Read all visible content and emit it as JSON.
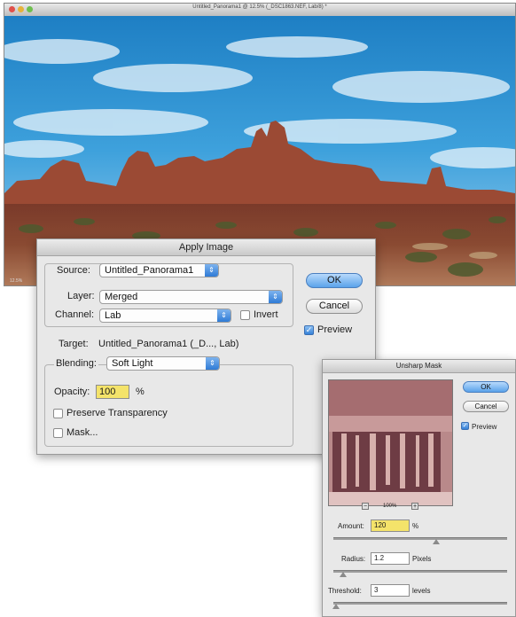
{
  "document_window": {
    "title": "Untitled_Panorama1 @ 12.5% (_DSC1863.NEF, Lab/8) *",
    "zoom": "12.5%"
  },
  "apply_image": {
    "title": "Apply Image",
    "source_label": "Source:",
    "source_value": "Untitled_Panorama1",
    "layer_label": "Layer:",
    "layer_value": "Merged",
    "channel_label": "Channel:",
    "channel_value": "Lab",
    "invert_label": "Invert",
    "invert_checked": false,
    "target_label": "Target:",
    "target_value": "Untitled_Panorama1 (_D..., Lab)",
    "blending_label": "Blending:",
    "blending_value": "Soft Light",
    "opacity_label": "Opacity:",
    "opacity_value": "100",
    "opacity_unit": "%",
    "preserve_transparency_label": "Preserve Transparency",
    "mask_label": "Mask...",
    "ok_label": "OK",
    "cancel_label": "Cancel",
    "preview_label": "Preview",
    "preview_checked": true
  },
  "unsharp_mask": {
    "title": "Unsharp Mask",
    "ok_label": "OK",
    "cancel_label": "Cancel",
    "preview_label": "Preview",
    "preview_checked": true,
    "zoom_level": "100%",
    "amount_label": "Amount:",
    "amount_value": "120",
    "amount_unit": "%",
    "radius_label": "Radius:",
    "radius_value": "1.2",
    "radius_unit": "Pixels",
    "threshold_label": "Threshold:",
    "threshold_value": "3",
    "threshold_unit": "levels"
  },
  "colors": {
    "default_button": "#5aa2ea",
    "field_highlight": "#f4e36a",
    "sky": "#2f8fd0",
    "rock": "#a4513a"
  }
}
